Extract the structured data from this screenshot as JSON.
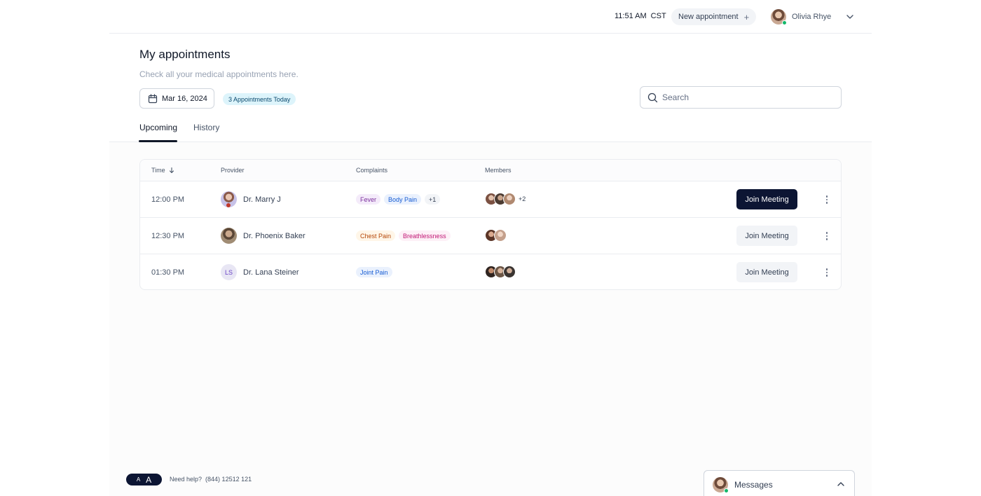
{
  "header": {
    "time": "11:51 AM",
    "timezone": "CST",
    "new_appointment_label": "New appointment",
    "new_appointment_icon": "+",
    "user_name": "Olivia Rhye"
  },
  "page": {
    "title": "My appointments",
    "subtitle": "Check all your medical appointments here.",
    "date": "Mar 16, 2024",
    "appointments_badge": "3 Appointments Today",
    "search_placeholder": "Search"
  },
  "tabs": [
    {
      "label": "Upcoming",
      "active": true
    },
    {
      "label": "History",
      "active": false
    }
  ],
  "table": {
    "columns": [
      "Time",
      "Provider",
      "Complaints",
      "Members"
    ],
    "rows": [
      {
        "time": "12:00 PM",
        "provider": "Dr. Marry J",
        "complaints": [
          {
            "label": "Fever",
            "color": "#7a2e9c",
            "bg": "#f4ebfa"
          },
          {
            "label": "Body Pain",
            "color": "#175cd3",
            "bg": "#eaf1fd"
          },
          {
            "label": "+1",
            "color": "#344054",
            "bg": "#f2f4f7"
          }
        ],
        "members_extra": "+2",
        "join_label": "Join Meeting",
        "primary": true
      },
      {
        "time": "12:30 PM",
        "provider": "Dr. Phoenix Baker",
        "complaints": [
          {
            "label": "Chest Pain",
            "color": "#b54708",
            "bg": "#fff6e8"
          },
          {
            "label": "Breathlessness",
            "color": "#c11574",
            "bg": "#fdf0f7"
          }
        ],
        "members_extra": "",
        "join_label": "Join Meeting",
        "primary": false
      },
      {
        "time": "01:30 PM",
        "provider": "Dr. Lana Steiner",
        "provider_initials": "LS",
        "complaints": [
          {
            "label": "Joint Pain",
            "color": "#175cd3",
            "bg": "#eaf1fd"
          }
        ],
        "members_extra": "",
        "join_label": "Join Meeting",
        "primary": false
      }
    ]
  },
  "footer": {
    "font_small": "A",
    "font_large": "A",
    "help_label": "Need help?",
    "help_phone": "(844) 12512 121",
    "messages_label": "Messages"
  },
  "icons": {
    "calendar": "calendar-icon",
    "search": "search-icon",
    "chevron_down": "chevron-down-icon",
    "chevron_up": "chevron-up-icon",
    "sort_arrow": "arrow-down-icon",
    "more": "more-vertical-icon"
  },
  "colors": {
    "primary": "#0c1533",
    "online": "#12b76a",
    "badge_bg": "#ddf4fb"
  }
}
